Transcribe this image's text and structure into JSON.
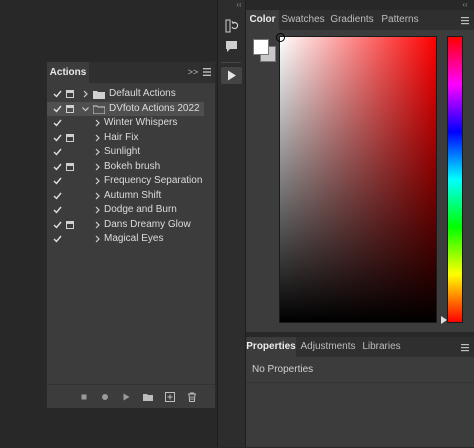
{
  "actions_panel": {
    "tab_label": "Actions",
    "collapse_glyph": ">>",
    "sets": [
      {
        "name": "Default Actions",
        "expanded": false,
        "selected": false
      },
      {
        "name": "DVfoto Actions 2022",
        "expanded": true,
        "selected": true
      }
    ],
    "actions": [
      {
        "name": "Winter Whispers",
        "dialog": false
      },
      {
        "name": "Hair Fix",
        "dialog": true
      },
      {
        "name": "Sunlight",
        "dialog": false
      },
      {
        "name": "Bokeh brush",
        "dialog": true
      },
      {
        "name": "Frequency Separation",
        "dialog": false
      },
      {
        "name": "Autumn Shift",
        "dialog": false
      },
      {
        "name": "Dodge and Burn",
        "dialog": false
      },
      {
        "name": "Dans Dreamy Glow",
        "dialog": true
      },
      {
        "name": "Magical Eyes",
        "dialog": false
      }
    ],
    "footer_icons": [
      "stop-icon",
      "record-icon",
      "play-icon",
      "new-set-folder-icon",
      "new-action-icon",
      "trash-icon"
    ]
  },
  "toolstrip": {
    "collapse_glyph": "‹‹",
    "icons": [
      "history-icon",
      "comment-icon",
      "actions-play-icon"
    ]
  },
  "color_panel": {
    "collapse_glyph": "‹‹",
    "tabs": [
      {
        "label": "Color",
        "active": true
      },
      {
        "label": "Swatches",
        "active": false
      },
      {
        "label": "Gradients",
        "active": false
      },
      {
        "label": "Patterns",
        "active": false
      }
    ],
    "foreground": "#ffffff",
    "background": "#c8c8c8",
    "hue": "#ff0000"
  },
  "properties_panel": {
    "tabs": [
      {
        "label": "Properties",
        "active": true
      },
      {
        "label": "Adjustments",
        "active": false
      },
      {
        "label": "Libraries",
        "active": false
      }
    ],
    "message": "No Properties"
  },
  "colors": {
    "app_background": "#282828",
    "panel": "#3c3c3c",
    "tabbar": "#2f2f2f",
    "selected_row": "#4f4f4f"
  }
}
